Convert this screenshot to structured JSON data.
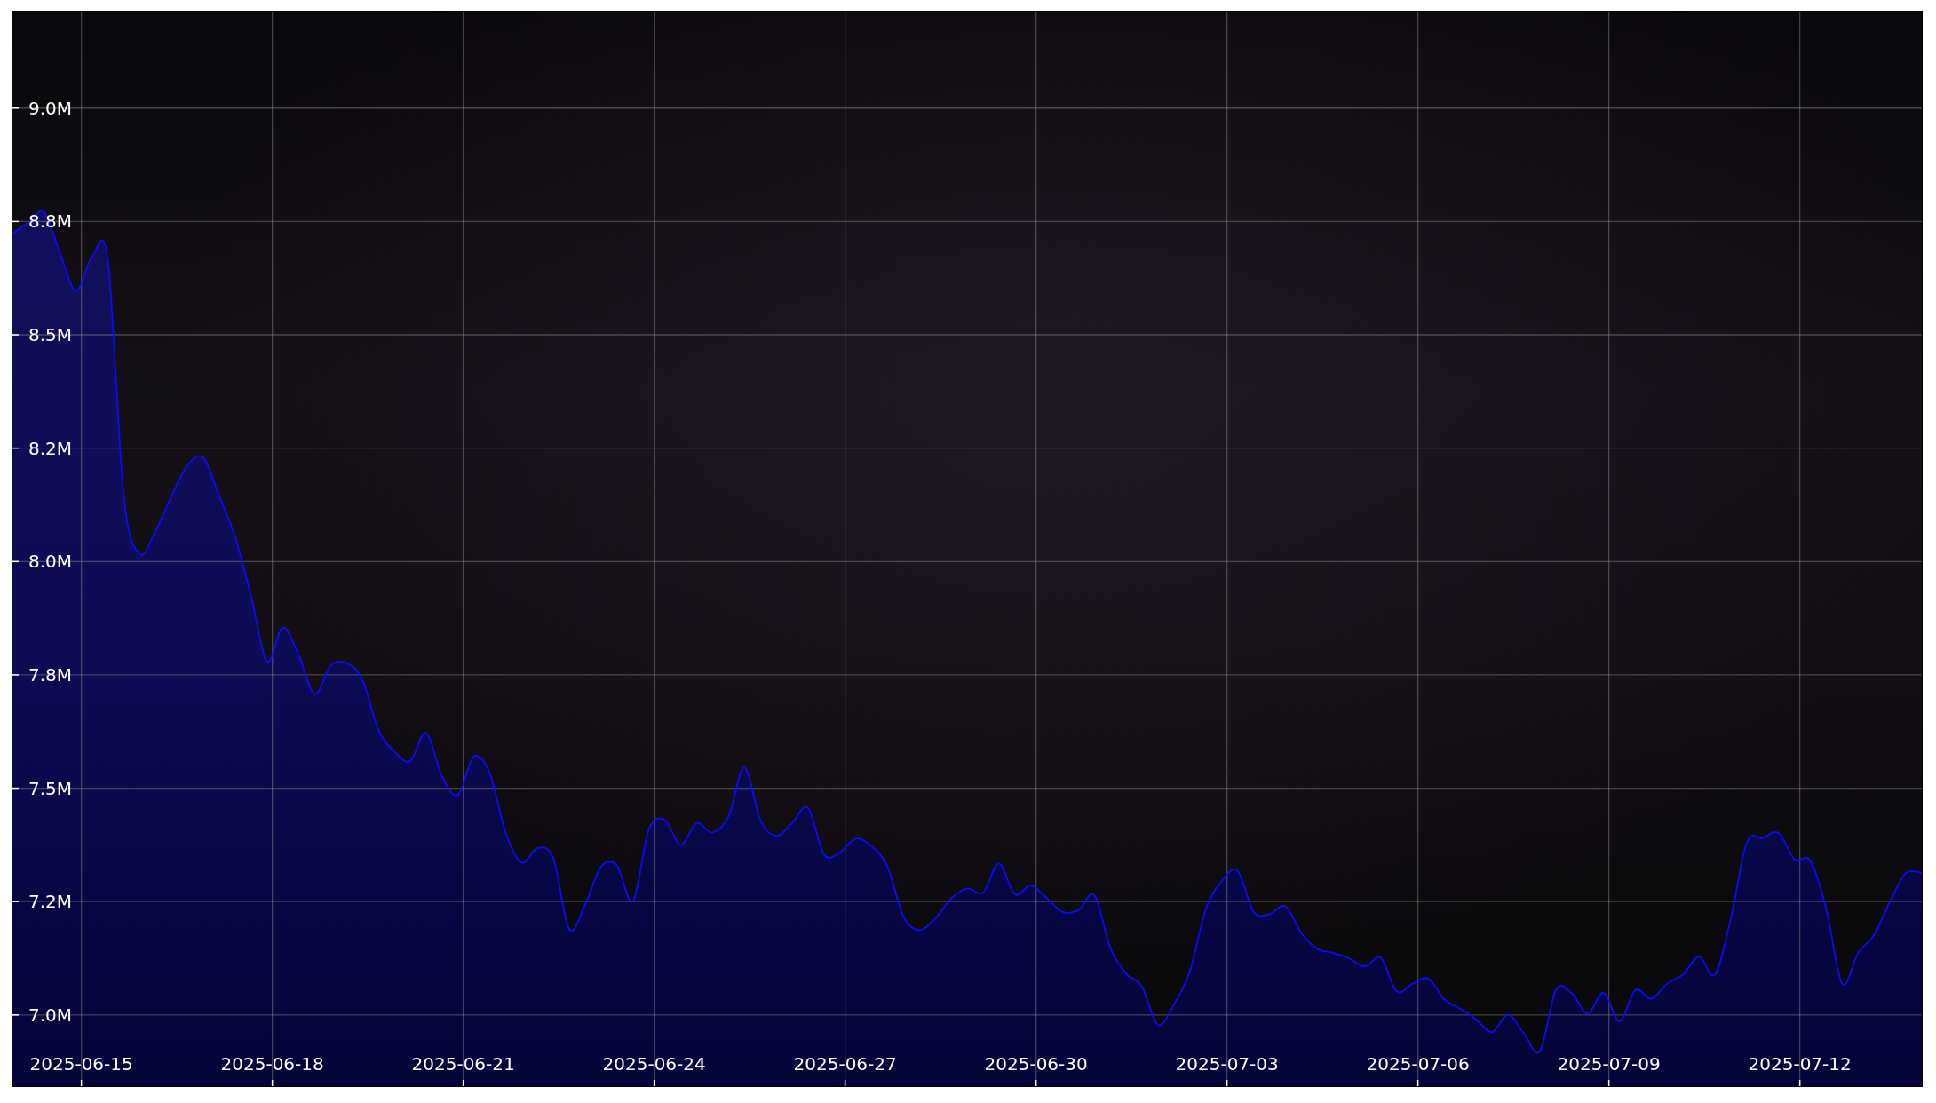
{
  "chart": {
    "chart_data": {
      "type": "area",
      "grid": true,
      "x": [
        "2025-06-13 22:00",
        "2025-06-14 04:00",
        "2025-06-14 10:00",
        "2025-06-14 16:00",
        "2025-06-14 22:00",
        "2025-06-15 04:00",
        "2025-06-15 10:00",
        "2025-06-15 16:00",
        "2025-06-15 22:00",
        "2025-06-16 04:00",
        "2025-06-16 10:00",
        "2025-06-16 16:00",
        "2025-06-16 22:00",
        "2025-06-17 04:00",
        "2025-06-17 10:00",
        "2025-06-17 16:00",
        "2025-06-17 22:00",
        "2025-06-18 04:00",
        "2025-06-18 10:00",
        "2025-06-18 16:00",
        "2025-06-18 22:00",
        "2025-06-19 04:00",
        "2025-06-19 10:00",
        "2025-06-19 16:00",
        "2025-06-19 22:00",
        "2025-06-20 04:00",
        "2025-06-20 10:00",
        "2025-06-20 16:00",
        "2025-06-20 22:00",
        "2025-06-21 04:00",
        "2025-06-21 10:00",
        "2025-06-21 16:00",
        "2025-06-21 22:00",
        "2025-06-22 04:00",
        "2025-06-22 10:00",
        "2025-06-22 16:00",
        "2025-06-22 22:00",
        "2025-06-23 04:00",
        "2025-06-23 10:00",
        "2025-06-23 16:00",
        "2025-06-23 22:00",
        "2025-06-24 04:00",
        "2025-06-24 10:00",
        "2025-06-24 16:00",
        "2025-06-24 22:00",
        "2025-06-25 04:00",
        "2025-06-25 10:00",
        "2025-06-25 16:00",
        "2025-06-25 22:00",
        "2025-06-26 04:00",
        "2025-06-26 10:00",
        "2025-06-26 16:00",
        "2025-06-26 22:00",
        "2025-06-27 04:00",
        "2025-06-27 10:00",
        "2025-06-27 16:00",
        "2025-06-27 22:00",
        "2025-06-28 04:00",
        "2025-06-28 10:00",
        "2025-06-28 16:00",
        "2025-06-28 22:00",
        "2025-06-29 04:00",
        "2025-06-29 10:00",
        "2025-06-29 16:00",
        "2025-06-29 22:00",
        "2025-06-30 04:00",
        "2025-06-30 10:00",
        "2025-06-30 16:00",
        "2025-06-30 22:00",
        "2025-07-01 04:00",
        "2025-07-01 10:00",
        "2025-07-01 16:00",
        "2025-07-01 22:00",
        "2025-07-02 04:00",
        "2025-07-02 10:00",
        "2025-07-02 16:00",
        "2025-07-02 22:00",
        "2025-07-03 04:00",
        "2025-07-03 10:00",
        "2025-07-03 16:00",
        "2025-07-03 22:00",
        "2025-07-04 04:00",
        "2025-07-04 10:00",
        "2025-07-04 16:00",
        "2025-07-04 22:00",
        "2025-07-05 04:00",
        "2025-07-05 10:00",
        "2025-07-05 16:00",
        "2025-07-05 22:00",
        "2025-07-06 04:00",
        "2025-07-06 10:00",
        "2025-07-06 16:00",
        "2025-07-06 22:00",
        "2025-07-07 04:00",
        "2025-07-07 10:00",
        "2025-07-07 16:00",
        "2025-07-07 22:00",
        "2025-07-08 04:00",
        "2025-07-08 10:00",
        "2025-07-08 16:00",
        "2025-07-08 22:00",
        "2025-07-09 04:00",
        "2025-07-09 10:00",
        "2025-07-09 16:00",
        "2025-07-09 22:00",
        "2025-07-10 04:00",
        "2025-07-10 10:00",
        "2025-07-10 16:00",
        "2025-07-10 22:00",
        "2025-07-11 04:00",
        "2025-07-11 10:00",
        "2025-07-11 16:00",
        "2025-07-11 22:00",
        "2025-07-12 04:00",
        "2025-07-12 10:00",
        "2025-07-12 16:00",
        "2025-07-12 22:00",
        "2025-07-13 04:00",
        "2025-07-13 10:00",
        "2025-07-13 16:00",
        "2025-07-13 22:00"
      ],
      "values": [
        8723000,
        8748000,
        8770000,
        8679000,
        8597000,
        8672000,
        8665000,
        8144000,
        8017000,
        8068000,
        8144000,
        8212000,
        8229000,
        8144000,
        8054000,
        7924000,
        7780000,
        7855000,
        7793000,
        7707000,
        7770000,
        7776000,
        7739000,
        7629000,
        7581000,
        7560000,
        7622000,
        7526000,
        7485000,
        7570000,
        7533000,
        7402000,
        7336000,
        7368000,
        7345000,
        7189000,
        7244000,
        7327000,
        7329000,
        7251000,
        7409000,
        7430000,
        7375000,
        7423000,
        7402000,
        7437000,
        7546000,
        7430000,
        7395000,
        7423000,
        7457000,
        7354000,
        7358000,
        7389000,
        7372000,
        7327000,
        7217000,
        7187000,
        7213000,
        7257000,
        7279000,
        7270000,
        7334000,
        7266000,
        7286000,
        7258000,
        7227000,
        7231000,
        7264000,
        7148000,
        7091000,
        7062000,
        6978000,
        7023000,
        7096000,
        7233000,
        7295000,
        7318000,
        7228000,
        7222000,
        7240000,
        7181000,
        7146000,
        7137000,
        7125000,
        7107000,
        7126000,
        7052000,
        7069000,
        7080000,
        7034000,
        7014000,
        6990000,
        6962000,
        7001000,
        6959000,
        6920000,
        7055000,
        7048000,
        7003000,
        7049000,
        6986000,
        7055000,
        7036000,
        7069000,
        7089000,
        7129000,
        7089000,
        7213000,
        7380000,
        7390000,
        7401000,
        7343000,
        7340000,
        7233000,
        7069000,
        7137000,
        7176000,
        7250000,
        7313000,
        7313000
      ],
      "xlim": [
        "2025-06-13 22:00",
        "2025-07-13 22:00"
      ],
      "ylim": [
        6843000,
        9213000
      ],
      "xticks": [
        "2025-06-15",
        "2025-06-18",
        "2025-06-21",
        "2025-06-24",
        "2025-06-27",
        "2025-06-30",
        "2025-07-03",
        "2025-07-06",
        "2025-07-09",
        "2025-07-12"
      ],
      "yticks": [
        {
          "value": 7000000,
          "label": "7.0M"
        },
        {
          "value": 7250000,
          "label": "7.2M"
        },
        {
          "value": 7500000,
          "label": "7.5M"
        },
        {
          "value": 7750000,
          "label": "7.8M"
        },
        {
          "value": 8000000,
          "label": "8.0M"
        },
        {
          "value": 8250000,
          "label": "8.2M"
        },
        {
          "value": 8500000,
          "label": "8.5M"
        },
        {
          "value": 8750000,
          "label": "8.8M"
        },
        {
          "value": 9000000,
          "label": "9.0M"
        }
      ]
    }
  }
}
